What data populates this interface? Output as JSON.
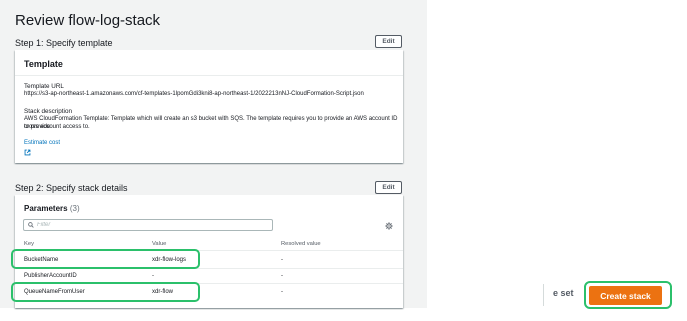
{
  "page": {
    "title": "Review flow-log-stack"
  },
  "step1": {
    "heading": "Step 1: Specify template",
    "edit_label": "Edit",
    "card_title": "Template",
    "template_url_label": "Template URL",
    "template_url_value": "https://s3-ap-northeast-1.amazonaws.com/cf-templates-1lpomGdi3kni8-ap-northeast-1/2022213nNJ-CloudFormation-Script.json",
    "stack_desc_label": "Stack description",
    "stack_desc_value_line1": "AWS CloudFormation Template: Template which will create an s3 bucket with SQS. The template requires you to provide an AWS account ID to provide",
    "stack_desc_value_line2": "cross account access to.",
    "estimate_cost_link": "Estimate cost",
    "external_icon": "external-link-icon"
  },
  "step2": {
    "heading": "Step 2: Specify stack details",
    "edit_label": "Edit",
    "params_title": "Parameters",
    "params_count": "(3)",
    "filter_placeholder": "Filter",
    "filter_icon": "search-icon",
    "settings_icon": "gear-icon",
    "columns": {
      "key": "Key",
      "value": "Value",
      "resolved": "Resolved value"
    },
    "rows": [
      {
        "key": "BucketName",
        "value": "xdr-flow-logs",
        "resolved": "-"
      },
      {
        "key": "PublisherAccountID",
        "value": "-",
        "resolved": "-"
      },
      {
        "key": "QueueNameFromUser",
        "value": "xdr-flow",
        "resolved": "-"
      }
    ]
  },
  "footer": {
    "partial_button_label": "e set",
    "create_label": "Create stack"
  },
  "colors": {
    "accent": "#ec7211",
    "highlight": "#2bc06b",
    "link": "#0073bb"
  }
}
